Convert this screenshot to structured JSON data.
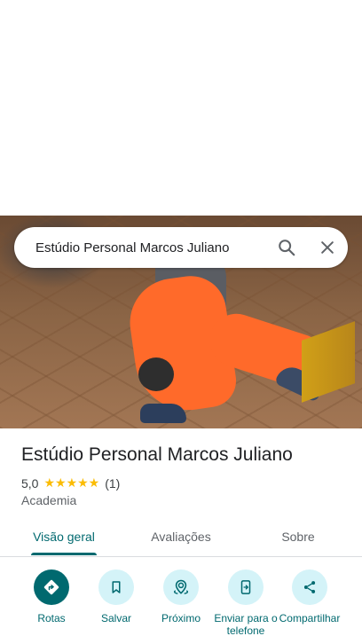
{
  "search": {
    "query": "Estúdio Personal Marcos Juliano"
  },
  "place": {
    "name": "Estúdio Personal Marcos Juliano",
    "rating_value": "5,0",
    "stars_display": "★★★★★",
    "rating_count": "(1)",
    "rating_fraction": 1.0,
    "category": "Academia"
  },
  "tabs": [
    {
      "label": "Visão geral",
      "active": true
    },
    {
      "label": "Avaliações",
      "active": false
    },
    {
      "label": "Sobre",
      "active": false
    }
  ],
  "actions": [
    {
      "label": "Rotas",
      "icon": "directions-icon"
    },
    {
      "label": "Salvar",
      "icon": "bookmark-icon"
    },
    {
      "label": "Próximo",
      "icon": "nearby-icon"
    },
    {
      "label": "Enviar para o telefone",
      "icon": "send-to-phone-icon"
    },
    {
      "label": "Compartilhar",
      "icon": "share-icon"
    }
  ],
  "colors": {
    "accent": "#00696f",
    "accent_light": "#d4f3f8",
    "star": "#fbbc04"
  }
}
